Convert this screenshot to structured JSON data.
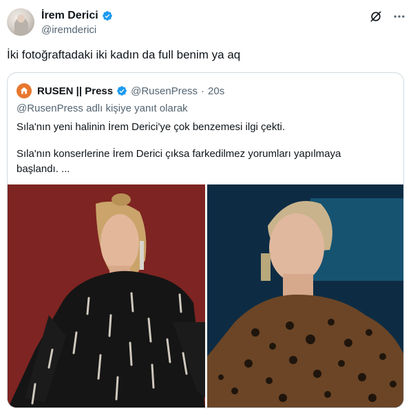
{
  "author": {
    "display_name": "İrem Derici",
    "handle": "@iremderici"
  },
  "tweet": {
    "text": "İki fotoğraftadaki iki kadın da full benim ya aq"
  },
  "header_icons": [
    "grok-icon",
    "more-icon"
  ],
  "quoted_tweet": {
    "display_name": "RUSEN || Press",
    "handle": "@RusenPress",
    "separator": "·",
    "time": "20s",
    "reply_context": "@RusenPress adlı kişiye yanıt olarak",
    "line1": "Sıla'nın yeni halinin İrem Derici'ye çok benzemesi ilgi çekti.",
    "line2": "Sıla'nın konserlerine İrem Derici çıksa farkedilmez yorumları yapılmaya",
    "line3": "başlandı. ...",
    "photos": [
      "photo-left",
      "photo-right"
    ]
  },
  "colors": {
    "verified": "#1d9bf0",
    "secondary_text": "#536471",
    "border": "#cfd9de",
    "press_avatar": "#e8772e"
  }
}
